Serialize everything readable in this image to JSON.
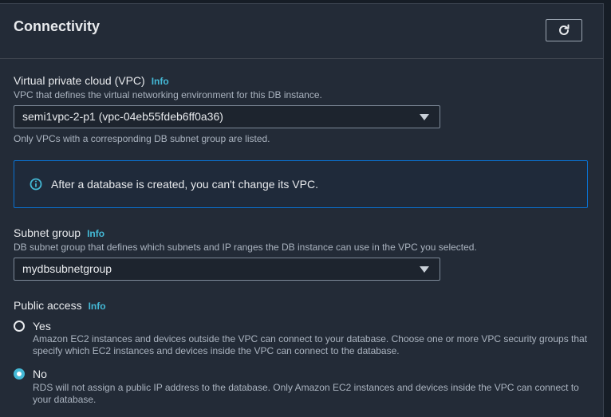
{
  "section": {
    "title": "Connectivity",
    "refresh_icon": "refresh-icon"
  },
  "vpc": {
    "label": "Virtual private cloud (VPC)",
    "info": "Info",
    "description": "VPC that defines the virtual networking environment for this DB instance.",
    "selected": "semi1vpc-2-p1 (vpc-04eb55fdeb6ff0a36)",
    "hint": "Only VPCs with a corresponding DB subnet group are listed."
  },
  "alert": {
    "icon": "info-circle-icon",
    "text": "After a database is created, you can't change its VPC."
  },
  "subnet_group": {
    "label": "Subnet group",
    "info": "Info",
    "description": "DB subnet group that defines which subnets and IP ranges the DB instance can use in the VPC you selected.",
    "selected": "mydbsubnetgroup"
  },
  "public_access": {
    "label": "Public access",
    "info": "Info",
    "options": [
      {
        "label": "Yes",
        "description": "Amazon EC2 instances and devices outside the VPC can connect to your database. Choose one or more VPC security groups that specify which EC2 instances and devices inside the VPC can connect to the database.",
        "selected": false
      },
      {
        "label": "No",
        "description": "RDS will not assign a public IP address to the database. Only Amazon EC2 instances and devices inside the VPC can connect to your database.",
        "selected": true
      }
    ]
  },
  "colors": {
    "accent": "#44b9d6",
    "alert_border": "#0972d3",
    "panel_bg": "#232b37"
  }
}
